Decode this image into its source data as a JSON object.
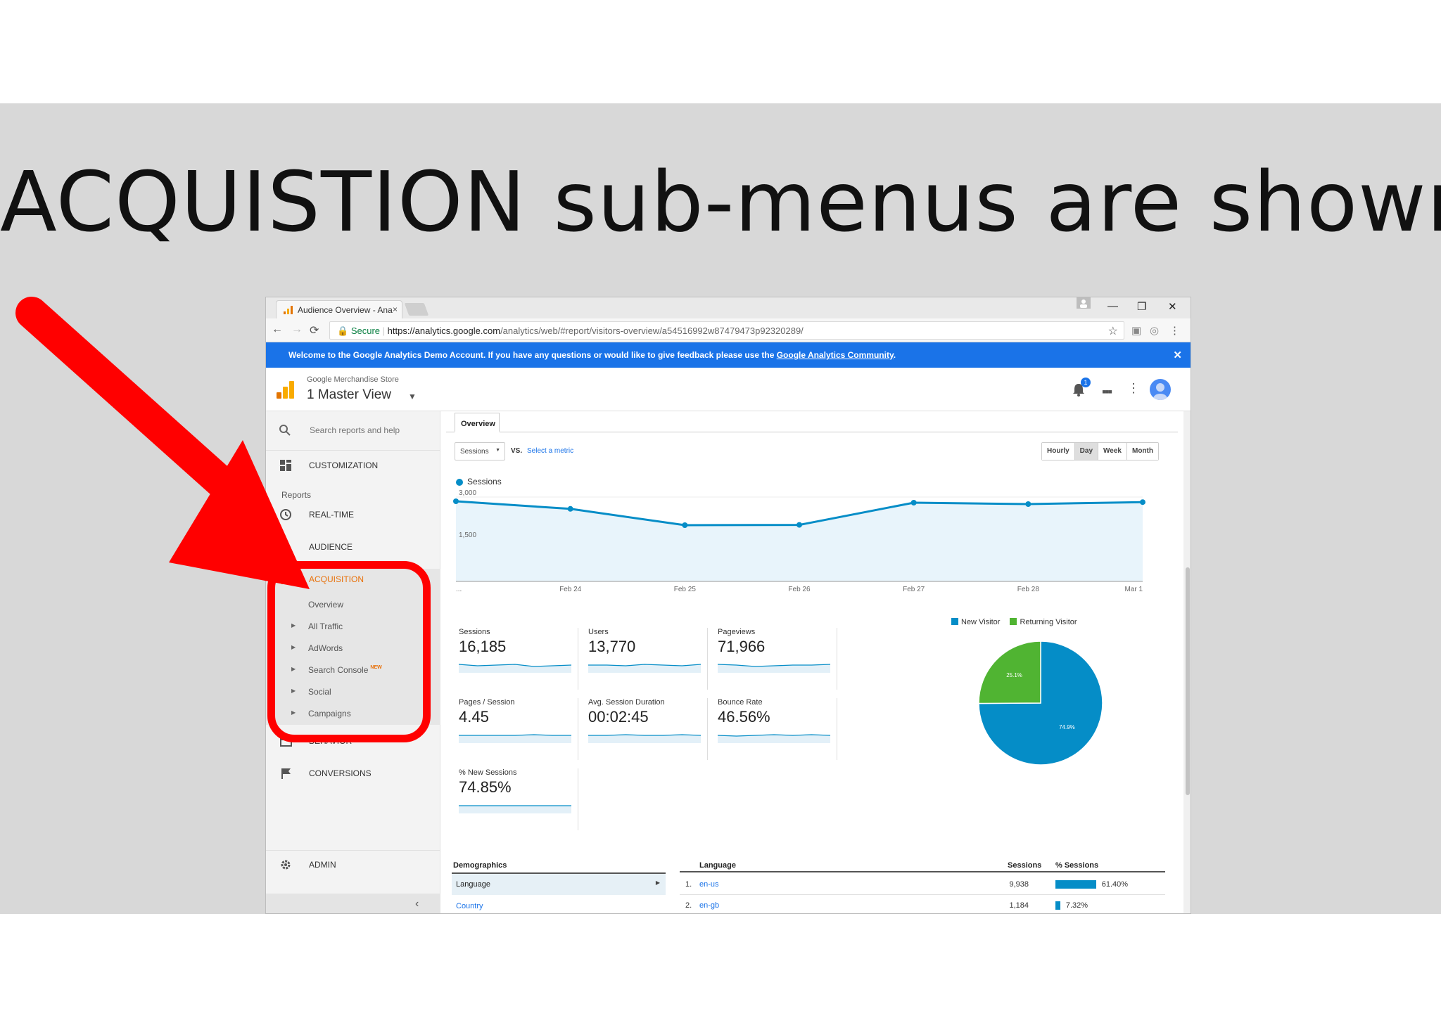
{
  "slide": {
    "headline": "ACQUISTION sub-menus are shown."
  },
  "browser": {
    "tab_title": "Audience Overview - Ana",
    "tab_close": "×",
    "window_controls": {
      "minimize": "—",
      "restore": "❐",
      "close": "✕"
    },
    "nav": {
      "back": "←",
      "forward": "→",
      "reload": "⟳"
    },
    "secure_label": "Secure",
    "url_host": "https://analytics.google.com",
    "url_path": "/analytics/web/#report/visitors-overview/a54516992w87479473p92320289/",
    "icons": [
      "star-icon",
      "pdf-extension-icon",
      "chrome-extension-icon",
      "menu-icon"
    ]
  },
  "banner": {
    "text": "Welcome to the Google Analytics Demo Account. If you have any questions or would like to give feedback please use the ",
    "link": "Google Analytics Community",
    "end": ".",
    "close": "✕",
    "color": "#1a73e8"
  },
  "header": {
    "account": "Google Merchandise Store",
    "view": "1 Master View",
    "notification_count": "1"
  },
  "sidebar": {
    "search_placeholder": "Search reports and help",
    "customization": "CUSTOMIZATION",
    "reports_label": "Reports",
    "realtime": "REAL-TIME",
    "audience": "AUDIENCE",
    "acquisition": "ACQUISITION",
    "acquisition_color": "#e8710a",
    "sub_items": [
      {
        "label": "Overview",
        "expandable": false
      },
      {
        "label": "All Traffic",
        "expandable": true
      },
      {
        "label": "AdWords",
        "expandable": true
      },
      {
        "label": "Search Console",
        "expandable": true,
        "badge": "NEW"
      },
      {
        "label": "Social",
        "expandable": true
      },
      {
        "label": "Campaigns",
        "expandable": true
      }
    ],
    "behavior": "BEHAVIOR",
    "conversions": "CONVERSIONS",
    "admin": "ADMIN"
  },
  "main": {
    "tab": "Overview",
    "metric_select": "Sessions",
    "vs": "VS.",
    "select_metric": "Select a metric",
    "periods": [
      {
        "label": "Hourly",
        "active": false
      },
      {
        "label": "Day",
        "active": true
      },
      {
        "label": "Week",
        "active": false
      },
      {
        "label": "Month",
        "active": false
      }
    ],
    "metrics": [
      {
        "name": "Sessions",
        "value": "16,185"
      },
      {
        "name": "Users",
        "value": "13,770"
      },
      {
        "name": "Pageviews",
        "value": "71,966"
      },
      {
        "name": "Pages / Session",
        "value": "4.45"
      },
      {
        "name": "Avg. Session Duration",
        "value": "00:02:45"
      },
      {
        "name": "Bounce Rate",
        "value": "46.56%"
      },
      {
        "name": "% New Sessions",
        "value": "74.85%"
      }
    ],
    "demographics": {
      "title": "Demographics",
      "language": "Language",
      "country": "Country"
    },
    "language_table": {
      "headers": {
        "language": "Language",
        "sessions": "Sessions",
        "pct": "% Sessions"
      },
      "rows": [
        {
          "idx": "1.",
          "name": "en-us",
          "sessions": "9,938",
          "pct": "61.40%",
          "share": 61.4
        },
        {
          "idx": "2.",
          "name": "en-gb",
          "sessions": "1,184",
          "pct": "7.32%",
          "share": 7.32
        }
      ]
    }
  },
  "chart_data": [
    {
      "type": "line",
      "series": [
        {
          "name": "Sessions",
          "color": "#058dc7",
          "values": [
            2850,
            2580,
            2000,
            2010,
            2800,
            2750,
            2820
          ]
        }
      ],
      "x_labels": [
        "...",
        "Feb 24",
        "Feb 25",
        "Feb 26",
        "Feb 27",
        "Feb 28",
        "Mar 1"
      ],
      "y_ticks": [
        "3,000",
        "1,500"
      ],
      "ylim": [
        0,
        3000
      ]
    },
    {
      "type": "pie",
      "slices": [
        {
          "name": "New Visitor",
          "value": 74.9,
          "label": "74.9%",
          "color": "#058dc7"
        },
        {
          "name": "Returning Visitor",
          "value": 25.1,
          "label": "25.1%",
          "color": "#50b432"
        }
      ]
    }
  ]
}
